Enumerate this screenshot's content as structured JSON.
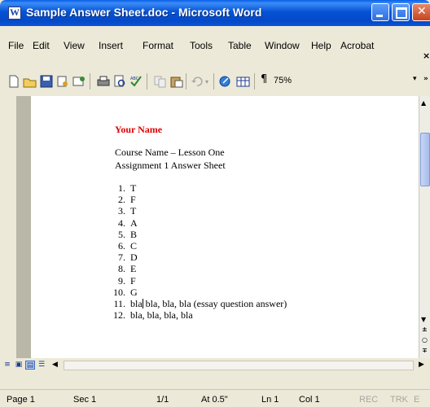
{
  "window": {
    "title": "Sample Answer Sheet.doc - Microsoft Word"
  },
  "menu": {
    "items": [
      "File",
      "Edit",
      "View",
      "Insert",
      "Format",
      "Tools",
      "Table",
      "Window",
      "Help",
      "Acrobat"
    ],
    "close_glyph": "×"
  },
  "toolbar": {
    "zoom": "75%",
    "pilcrow": "¶"
  },
  "document": {
    "name": "Your Name",
    "course": "Course Name – Lesson One",
    "assignment": "Assignment 1 Answer Sheet",
    "answers": [
      {
        "num": "1.",
        "text": "T"
      },
      {
        "num": "2.",
        "text": "F"
      },
      {
        "num": "3.",
        "text": "T"
      },
      {
        "num": "4.",
        "text": "A"
      },
      {
        "num": "5.",
        "text": "B"
      },
      {
        "num": "6.",
        "text": "C"
      },
      {
        "num": "7.",
        "text": "D"
      },
      {
        "num": "8.",
        "text": "E"
      },
      {
        "num": "9.",
        "text": "F"
      },
      {
        "num": "10.",
        "text": "G"
      },
      {
        "num": "11.",
        "text_before": "bla",
        "text_after": " bla, bla, bla (essay question answer)"
      },
      {
        "num": "12.",
        "text": "bla, bla, bla, bla"
      }
    ]
  },
  "status": {
    "page": "Page 1",
    "sec": "Sec 1",
    "pages": "1/1",
    "at": "At 0.5\"",
    "ln": "Ln 1",
    "col": "Col 1",
    "rec": "REC",
    "trk": "TRK",
    "ext": "E"
  }
}
